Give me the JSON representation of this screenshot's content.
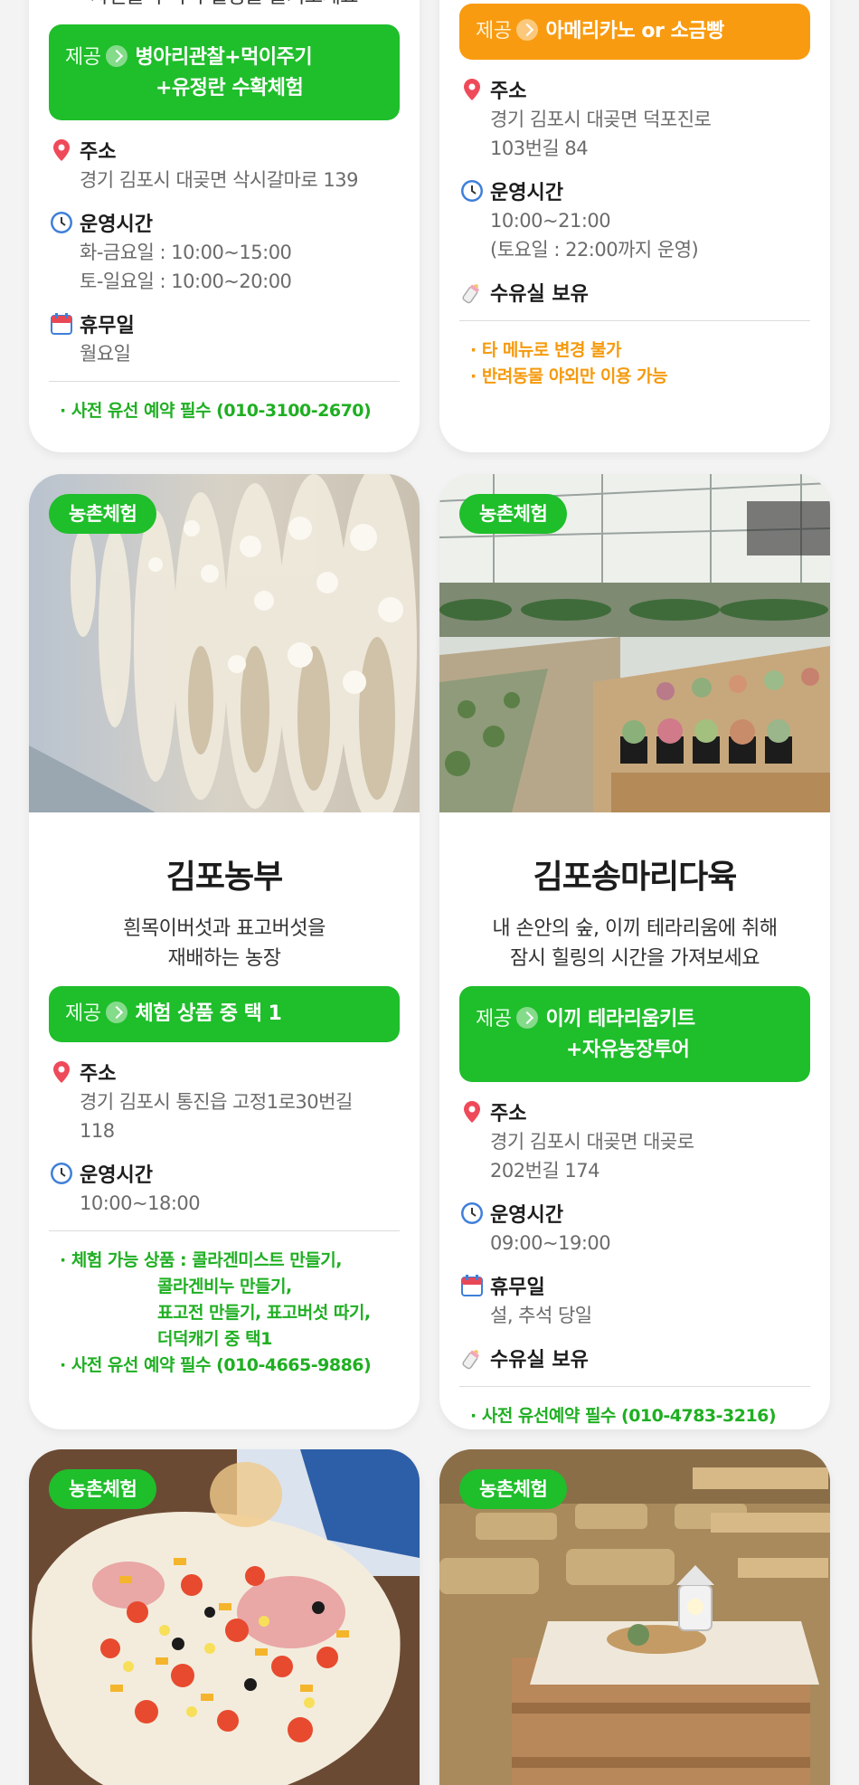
{
  "cards": [
    {
      "id": "c1",
      "desc_tail": "자연을 누비며 힐링을 즐겨보세요",
      "provide_label": "제공",
      "provide_line1": "병아리관찰+먹이주기",
      "provide_line2": "+유정란 수확체험",
      "address_label": "주소",
      "address": "경기 김포시 대곶면 삭시갈마로 139",
      "hours_label": "운영시간",
      "hours_line1": "화-금요일 : 10:00~15:00",
      "hours_line2": "토-일요일 : 10:00~20:00",
      "holiday_label": "휴무일",
      "holiday": "월요일",
      "note1": "· 사전 유선 예약 필수 (010-3100-2670)"
    },
    {
      "id": "c2",
      "provide_label": "제공",
      "provide_line1": "아메리카노 or 소금빵",
      "address_label": "주소",
      "address_line1": "경기 김포시 대곶면 덕포진로",
      "address_line2": "103번길 84",
      "hours_label": "운영시간",
      "hours_line1": "10:00~21:00",
      "hours_line2": "(토요일 : 22:00까지 운영)",
      "nursing_label": "수유실 보유",
      "note1": "· 타 메뉴로 변경 불가",
      "note2": "· 반려동물 야외만 이용 가능"
    },
    {
      "id": "c3",
      "tag": "농촌체험",
      "title": "김포농부",
      "desc_line1": "흰목이버섯과 표고버섯을",
      "desc_line2": "재배하는 농장",
      "provide_label": "제공",
      "provide_line1": "체험 상품 중 택 1",
      "address_label": "주소",
      "address_line1": "경기 김포시 통진읍 고정1로30번길",
      "address_line2": "118",
      "hours_label": "운영시간",
      "hours_line1": "10:00~18:00",
      "note1": "· 체험 가능 상품 : 콜라겐미스트 만들기,",
      "note2": "콜라겐비누 만들기,",
      "note3": "표고전 만들기, 표고버섯 따기,",
      "note4": "더덕캐기 중 택1",
      "note5": "· 사전 유선 예약 필수 (010-4665-9886)"
    },
    {
      "id": "c4",
      "tag": "농촌체험",
      "title": "김포송마리다육",
      "desc_line1": "내 손안의 숲, 이끼 테라리움에 취해",
      "desc_line2": "잠시 힐링의 시간을 가져보세요",
      "provide_label": "제공",
      "provide_line1": "이끼 테라리움키트",
      "provide_line2": "+자유농장투어",
      "address_label": "주소",
      "address_line1": "경기 김포시 대곶면 대곶로",
      "address_line2": "202번길 174",
      "hours_label": "운영시간",
      "hours_line1": "09:00~19:00",
      "holiday_label": "휴무일",
      "holiday": "설, 추석 당일",
      "nursing_label": "수유실 보유",
      "note1": "· 사전 유선예약 필수 (010-4783-3216)"
    },
    {
      "id": "c5",
      "tag": "농촌체험"
    },
    {
      "id": "c6",
      "tag": "농촌체험"
    }
  ],
  "colors": {
    "green": "#1fbe2b",
    "orange": "#f99b10",
    "pin": "#ef4a5a",
    "clock": "#3f7fd9"
  },
  "icons": [
    "pin-icon",
    "clock-icon",
    "calendar-icon",
    "baby-bottle-icon",
    "arrow-right-circle-icon"
  ]
}
